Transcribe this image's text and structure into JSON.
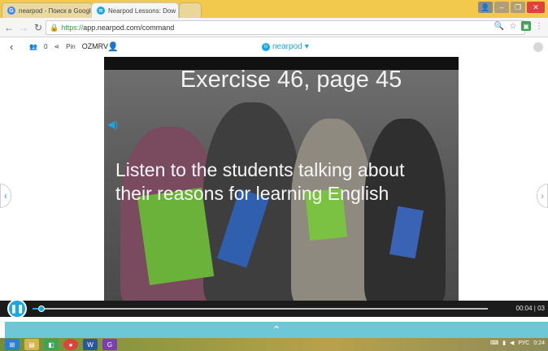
{
  "browser": {
    "tabs": [
      {
        "title": "nearpod - Поиск в Googl",
        "active": false
      },
      {
        "title": "Nearpod Lessons: Dow",
        "active": true
      }
    ],
    "url_scheme": "https://",
    "url_rest": "app.nearpod.com/command",
    "colors": {
      "tabstrip": "#f2c94c",
      "close": "#d9453a"
    }
  },
  "nearpod_header": {
    "student_count": "0",
    "pin_label": "Pin",
    "pin_code": "OZMRV",
    "logo_text": "nearpod"
  },
  "slide": {
    "title": "Exercise 46, page 45",
    "body": "Listen to the students talking about their reasons for learning English"
  },
  "media": {
    "progress_fraction": 0.02,
    "time_text": "00:04 | 03"
  },
  "taskbar": {
    "tray_lang": "РУС",
    "tray_time": "0:24"
  },
  "icons": {
    "back": "chevron-left-icon",
    "speaker": "speaker-icon",
    "pause": "pause-icon",
    "expand": "chevron-up-icon"
  },
  "accent": "#1aa7e6"
}
